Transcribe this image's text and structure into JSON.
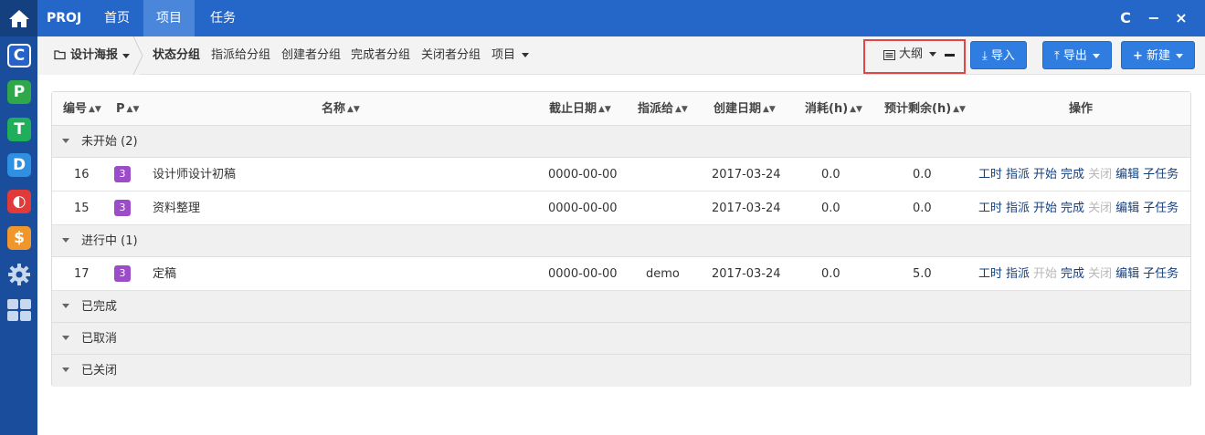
{
  "topbar": {
    "brand": "PROJ",
    "nav": [
      "首页",
      "项目",
      "任务"
    ],
    "window_buttons": [
      "C",
      "−",
      "×"
    ]
  },
  "subbar": {
    "project": "设计海报",
    "groups": [
      "状态分组",
      "指派给分组",
      "创建者分组",
      "完成者分组",
      "关闭者分组",
      "项目"
    ],
    "outline": "大纲",
    "import": "导入",
    "export": "导出",
    "new": "新建"
  },
  "table": {
    "headers": {
      "id": "编号",
      "pri": "P",
      "name": "名称",
      "deadline": "截止日期",
      "assigned": "指派给",
      "created": "创建日期",
      "consumed": "消耗(h)",
      "left": "预计剩余(h)",
      "actions": "操作"
    },
    "groups": [
      {
        "label": "未开始 (2)",
        "rows": [
          {
            "id": "16",
            "pri": "3",
            "name": "设计师设计初稿",
            "deadline": "0000-00-00",
            "assigned": "",
            "created": "2017-03-24",
            "consumed": "0.0",
            "left": "0.0",
            "start_enabled": true
          },
          {
            "id": "15",
            "pri": "3",
            "name": "资料整理",
            "deadline": "0000-00-00",
            "assigned": "",
            "created": "2017-03-24",
            "consumed": "0.0",
            "left": "0.0",
            "start_enabled": true
          }
        ]
      },
      {
        "label": "进行中 (1)",
        "rows": [
          {
            "id": "17",
            "pri": "3",
            "name": "定稿",
            "deadline": "0000-00-00",
            "assigned": "demo",
            "created": "2017-03-24",
            "consumed": "0.0",
            "left": "5.0",
            "start_enabled": false
          }
        ]
      },
      {
        "label": "已完成",
        "rows": []
      },
      {
        "label": "已取消",
        "rows": []
      },
      {
        "label": "已关闭",
        "rows": []
      }
    ],
    "action_labels": [
      "工时",
      "指派",
      "开始",
      "完成",
      "关闭",
      "编辑",
      "子任务"
    ]
  },
  "colors": {
    "topbar": "#2567c8",
    "rail": "#1a4d9b",
    "button": "#2f7de1",
    "priority_badge": "#9c4bc9",
    "highlight": "#e04646"
  }
}
